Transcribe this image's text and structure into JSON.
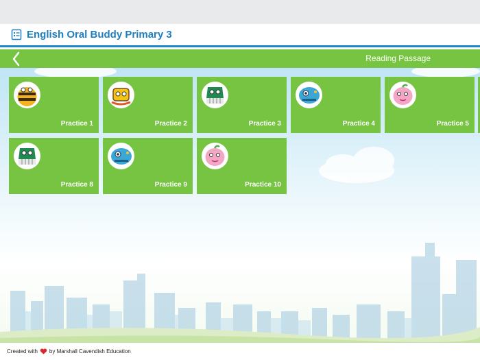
{
  "header": {
    "title": "English Oral Buddy Primary 3",
    "icon": "book-list-icon",
    "accent_color": "#1d86c8"
  },
  "navbar": {
    "title": "Reading Passage",
    "back_icon": "chevron-left-icon",
    "color": "#76c442"
  },
  "practices": [
    {
      "label": "Practice 1",
      "character": "bee-robot"
    },
    {
      "label": "Practice 2",
      "character": "yellow-tv-robot"
    },
    {
      "label": "Practice 3",
      "character": "green-shoe-robot"
    },
    {
      "label": "Practice 4",
      "character": "blue-fish-robot"
    },
    {
      "label": "Practice 5",
      "character": "pink-blob"
    },
    {
      "label": "Practice 8",
      "character": "green-shoe-robot"
    },
    {
      "label": "Practice 9",
      "character": "blue-fish-robot"
    },
    {
      "label": "Practice 10",
      "character": "pink-blob"
    }
  ],
  "footer": {
    "prefix": "Created with",
    "suffix": "by Marshall Cavendish Education",
    "icon": "heart-icon"
  }
}
